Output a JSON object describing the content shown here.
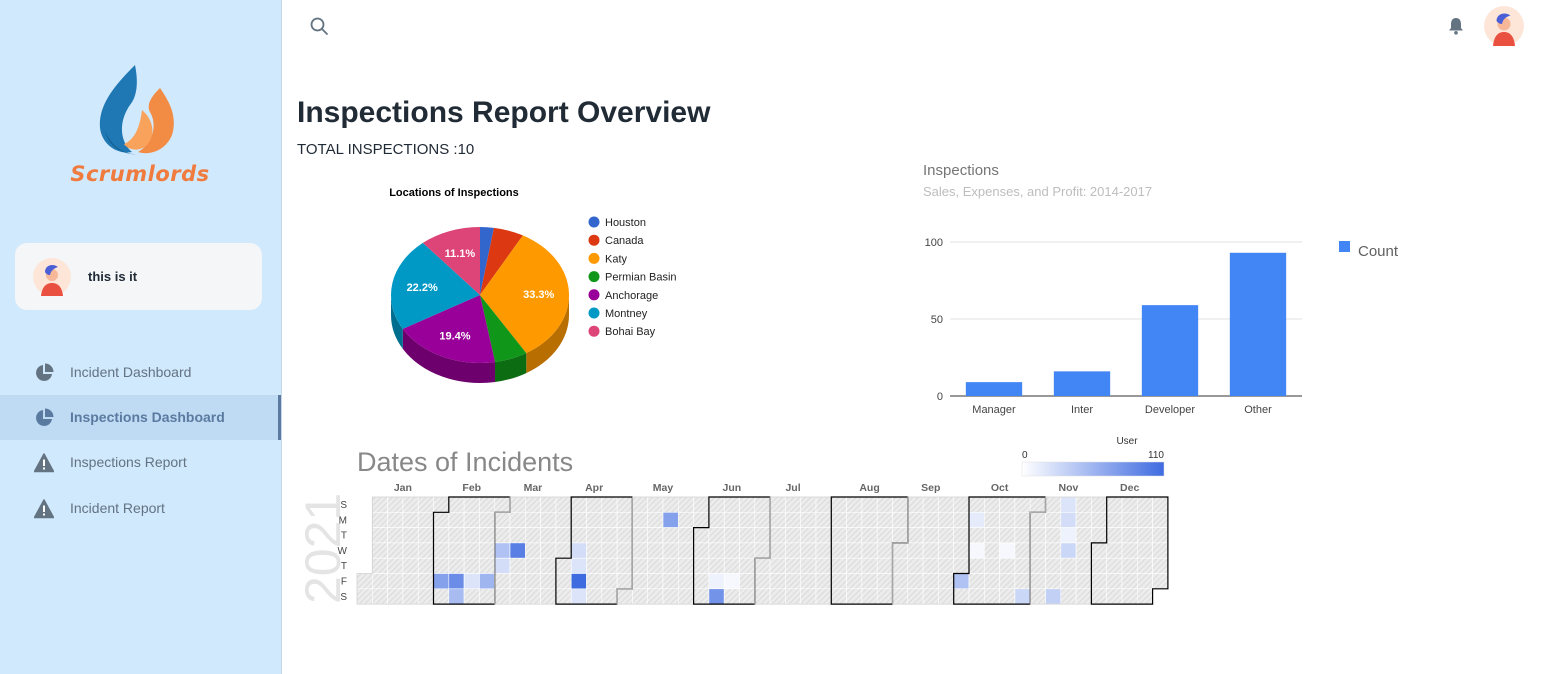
{
  "sidebar": {
    "brand": "Scrumlords",
    "user_name": "this is it",
    "nav": [
      {
        "label": "Incident Dashboard",
        "icon": "pie-chart-icon",
        "active": false
      },
      {
        "label": "Inspections Dashboard",
        "icon": "pie-chart-icon",
        "active": true
      },
      {
        "label": "Inspections Report",
        "icon": "alert-triangle-icon",
        "active": false
      },
      {
        "label": "Incident Report",
        "icon": "alert-triangle-icon",
        "active": false
      }
    ]
  },
  "topbar": {
    "search_icon": "search-icon",
    "bell_icon": "bell-icon"
  },
  "main": {
    "title": "Inspections Report Overview",
    "total_inspections": "TOTAL INSPECTIONS :10"
  },
  "colors": {
    "accent": "#4285f4",
    "sidebar_bg": "#d1e9fc"
  },
  "chart_data": [
    {
      "type": "pie",
      "title": "Locations of Inspections",
      "labels": [
        "Houston",
        "Canada",
        "Katy",
        "Permian Basin",
        "Anchorage",
        "Montney",
        "Bohai Bay"
      ],
      "values": [
        2.5,
        5.5,
        33.3,
        6.0,
        19.4,
        22.2,
        11.1
      ],
      "data_labels": [
        "",
        "",
        "33.3%",
        "",
        "19.4%",
        "22.2%",
        "11.1%"
      ],
      "colors": [
        "#3366cc",
        "#dc3912",
        "#ff9900",
        "#109618",
        "#990099",
        "#0099c6",
        "#dd4477"
      ],
      "legend_position": "right"
    },
    {
      "type": "bar",
      "title": "Inspections",
      "subtitle": "Sales, Expenses, and Profit: 2014-2017",
      "categories": [
        "Manager",
        "Inter",
        "Developer",
        "Other"
      ],
      "series": [
        {
          "name": "Count",
          "values": [
            9,
            16,
            59,
            93
          ]
        }
      ],
      "ylim": [
        0,
        100
      ],
      "yticks": [
        0,
        50,
        100
      ],
      "grid": true,
      "legend_position": "right",
      "color": "#4285f4"
    },
    {
      "type": "heatmap",
      "title": "Dates of Incidents",
      "year": "2021",
      "months": [
        "Jan",
        "Feb",
        "Mar",
        "Apr",
        "May",
        "Jun",
        "Jul",
        "Aug",
        "Sep",
        "Oct",
        "Nov",
        "Dec"
      ],
      "weekdays": [
        "S",
        "M",
        "T",
        "W",
        "T",
        "F",
        "S"
      ],
      "legend_title": "User",
      "legend_min": 0,
      "legend_max": 110,
      "cells": [
        {
          "date": "2021-02-05",
          "value": 70
        },
        {
          "date": "2021-02-12",
          "value": 85
        },
        {
          "date": "2021-02-13",
          "value": 50
        },
        {
          "date": "2021-02-19",
          "value": 20
        },
        {
          "date": "2021-02-26",
          "value": 55
        },
        {
          "date": "2021-03-03",
          "value": 45
        },
        {
          "date": "2021-03-04",
          "value": 25
        },
        {
          "date": "2021-03-10",
          "value": 95
        },
        {
          "date": "2021-04-07",
          "value": 25
        },
        {
          "date": "2021-04-08",
          "value": 20
        },
        {
          "date": "2021-04-09",
          "value": 110
        },
        {
          "date": "2021-04-10",
          "value": 20
        },
        {
          "date": "2021-05-17",
          "value": 70
        },
        {
          "date": "2021-06-11",
          "value": 10
        },
        {
          "date": "2021-06-12",
          "value": 80
        },
        {
          "date": "2021-06-18",
          "value": 5
        },
        {
          "date": "2021-10-01",
          "value": 45
        },
        {
          "date": "2021-10-04",
          "value": 15
        },
        {
          "date": "2021-10-06",
          "value": 5
        },
        {
          "date": "2021-10-20",
          "value": 5
        },
        {
          "date": "2021-10-30",
          "value": 30
        },
        {
          "date": "2021-11-13",
          "value": 35
        },
        {
          "date": "2021-11-14",
          "value": 20
        },
        {
          "date": "2021-11-15",
          "value": 25
        },
        {
          "date": "2021-11-16",
          "value": 10
        },
        {
          "date": "2021-11-17",
          "value": 30
        }
      ]
    }
  ]
}
